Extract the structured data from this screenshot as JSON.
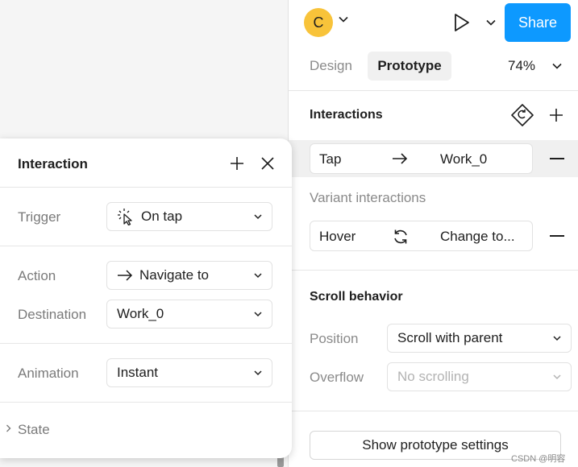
{
  "header": {
    "avatar_letter": "C",
    "share_label": "Share",
    "tabs": [
      {
        "label": "Design",
        "active": false
      },
      {
        "label": "Prototype",
        "active": true
      }
    ],
    "zoom": "74%"
  },
  "interactions": {
    "title": "Interactions",
    "rows": [
      {
        "trigger": "Tap",
        "action": "Work_0",
        "icon": "arrow-right-icon"
      }
    ],
    "variant_title": "Variant interactions",
    "variant_rows": [
      {
        "trigger": "Hover",
        "action": "Change to...",
        "icon": "refresh-icon"
      }
    ]
  },
  "scroll": {
    "title": "Scroll behavior",
    "position_label": "Position",
    "position_value": "Scroll with parent",
    "overflow_label": "Overflow",
    "overflow_value": "No scrolling"
  },
  "settings_button": "Show prototype settings",
  "watermark": "CSDN @明容",
  "popup": {
    "title": "Interaction",
    "trigger_label": "Trigger",
    "trigger_value": "On tap",
    "action_label": "Action",
    "action_value": "Navigate to",
    "destination_label": "Destination",
    "destination_value": "Work_0",
    "animation_label": "Animation",
    "animation_value": "Instant",
    "state_label": "State"
  },
  "colors": {
    "accent": "#0d99ff",
    "avatar": "#f8c33a"
  }
}
